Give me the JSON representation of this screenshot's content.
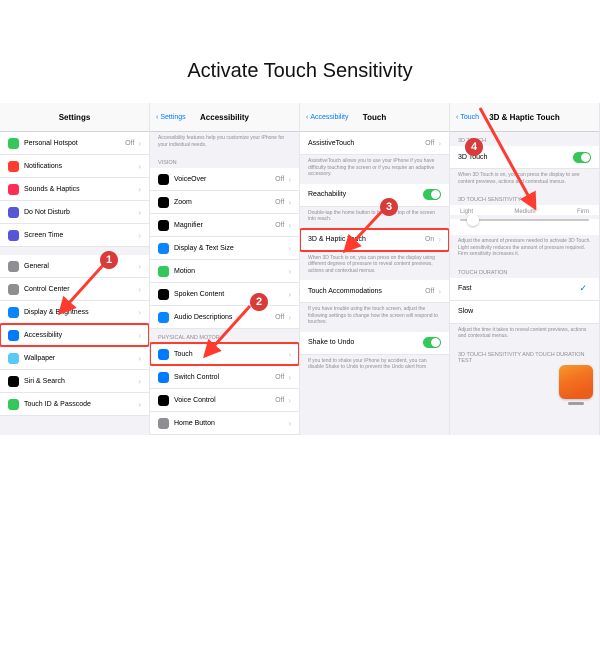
{
  "title": "Activate Touch Sensitivity",
  "panel1": {
    "headerTitle": "Settings",
    "rows": [
      {
        "icon": "#34c759",
        "label": "Personal Hotspot",
        "value": "Off"
      },
      {
        "icon": "#ff3b30",
        "label": "Notifications"
      },
      {
        "icon": "#ff2d55",
        "label": "Sounds & Haptics"
      },
      {
        "icon": "#5856d6",
        "label": "Do Not Disturb"
      },
      {
        "icon": "#5856d6",
        "label": "Screen Time"
      },
      {
        "spacer": true
      },
      {
        "icon": "#8e8e93",
        "label": "General"
      },
      {
        "icon": "#8e8e93",
        "label": "Control Center"
      },
      {
        "icon": "#0a84ff",
        "label": "Display & Brightness"
      },
      {
        "icon": "#007aff",
        "label": "Accessibility",
        "highlight": true
      },
      {
        "icon": "#5ac8fa",
        "label": "Wallpaper"
      },
      {
        "icon": "#000000",
        "label": "Siri & Search"
      },
      {
        "icon": "#34c759",
        "label": "Touch ID & Passcode"
      }
    ]
  },
  "panel2": {
    "back": "Settings",
    "headerTitle": "Accessibility",
    "intro": "Accessibility features help you customize your iPhone for your individual needs.",
    "section1": "VISION",
    "visionRows": [
      {
        "icon": "#000",
        "label": "VoiceOver",
        "value": "Off"
      },
      {
        "icon": "#000",
        "label": "Zoom",
        "value": "Off"
      },
      {
        "icon": "#000",
        "label": "Magnifier",
        "value": "Off"
      },
      {
        "icon": "#0a84ff",
        "label": "Display & Text Size"
      },
      {
        "icon": "#34c759",
        "label": "Motion"
      },
      {
        "icon": "#000",
        "label": "Spoken Content"
      },
      {
        "icon": "#0a84ff",
        "label": "Audio Descriptions",
        "value": "Off"
      }
    ],
    "section2": "PHYSICAL AND MOTOR",
    "motorRows": [
      {
        "icon": "#007aff",
        "label": "Touch",
        "highlight": true
      },
      {
        "icon": "#007aff",
        "label": "Switch Control",
        "value": "Off"
      },
      {
        "icon": "#000",
        "label": "Voice Control",
        "value": "Off"
      },
      {
        "icon": "#8e8e93",
        "label": "Home Button"
      }
    ]
  },
  "panel3": {
    "back": "Accessibility",
    "headerTitle": "Touch",
    "groups": [
      {
        "row": {
          "label": "AssistiveTouch",
          "value": "Off"
        },
        "foot": "AssistiveTouch allows you to use your iPhone if you have difficulty touching the screen or if you require an adaptive accessory."
      },
      {
        "row": {
          "label": "Reachability",
          "toggle": "on"
        },
        "foot": "Double-tap the home button to bring the top of the screen into reach."
      },
      {
        "row": {
          "label": "3D & Haptic Touch",
          "value": "On",
          "highlight": true
        },
        "foot": "When 3D Touch is on, you can press on the display using different degrees of pressure to reveal content previews, actions and contextual menus."
      },
      {
        "row": {
          "label": "Touch Accommodations",
          "value": "Off"
        },
        "foot": "If you have trouble using the touch screen, adjust the following settings to change how the screen will respond to touches."
      },
      {
        "row": {
          "label": "Shake to Undo",
          "toggle": "on"
        },
        "foot": "If you tend to shake your iPhone by accident, you can disable Shake to Undo to prevent the Undo alert from"
      }
    ]
  },
  "panel4": {
    "back": "Touch",
    "headerTitle": "3D & Haptic Touch",
    "section1": "3D TOUCH",
    "row1": {
      "label": "3D Touch",
      "toggle": "on"
    },
    "foot1": "When 3D Touch is on, you can press the display to see content previews, actions and contextual menus.",
    "section2": "3D TOUCH SENSITIVITY",
    "sliderLabels": {
      "l": "Light",
      "m": "Medium",
      "r": "Firm"
    },
    "foot2": "Adjust the amount of pressure needed to activate 3D Touch. Light sensitivity reduces the amount of pressure required. Firm sensitivity increases it.",
    "section3": "TOUCH DURATION",
    "durRows": [
      {
        "label": "Fast",
        "checked": true
      },
      {
        "label": "Slow"
      }
    ],
    "foot3": "Adjust the time it takes to reveal content previews, actions and contextual menus.",
    "section4": "3D TOUCH SENSITIVITY AND TOUCH DURATION TEST"
  }
}
